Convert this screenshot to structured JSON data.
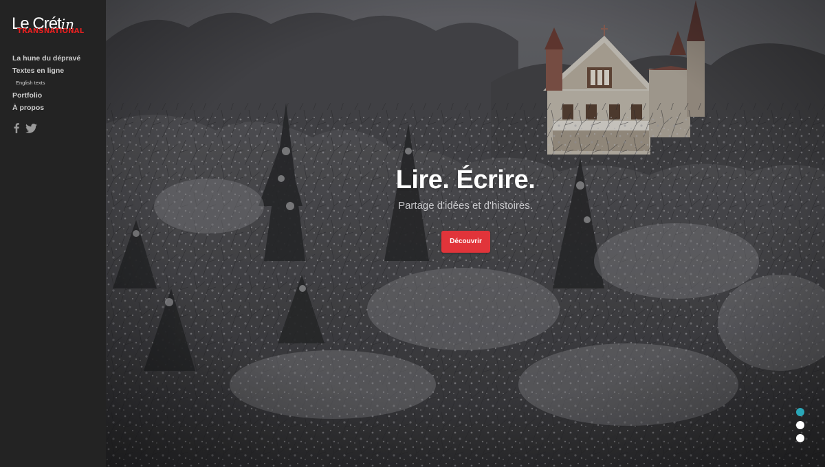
{
  "brand": {
    "logo_main": "Le Crét",
    "logo_script": "in",
    "logo_sub": "TRANSNATIONAL"
  },
  "sidebar": {
    "items": [
      {
        "label": "La hune du dépravé"
      },
      {
        "label": "Textes en ligne"
      },
      {
        "label": "English texts"
      },
      {
        "label": "Portfolio"
      },
      {
        "label": "À propos"
      }
    ],
    "social": [
      "facebook-icon",
      "twitter-icon"
    ]
  },
  "hero": {
    "title": "Lire. Écrire.",
    "subtitle": "Partage d'idées et d'histoires.",
    "cta_label": "Découvrir"
  },
  "slider": {
    "count": 3,
    "active_index": 0,
    "active_color": "#2aa7b8"
  },
  "colors": {
    "sidebar_bg": "#232323",
    "accent_red": "#e1343a",
    "nav_text": "#cfcfcf"
  }
}
